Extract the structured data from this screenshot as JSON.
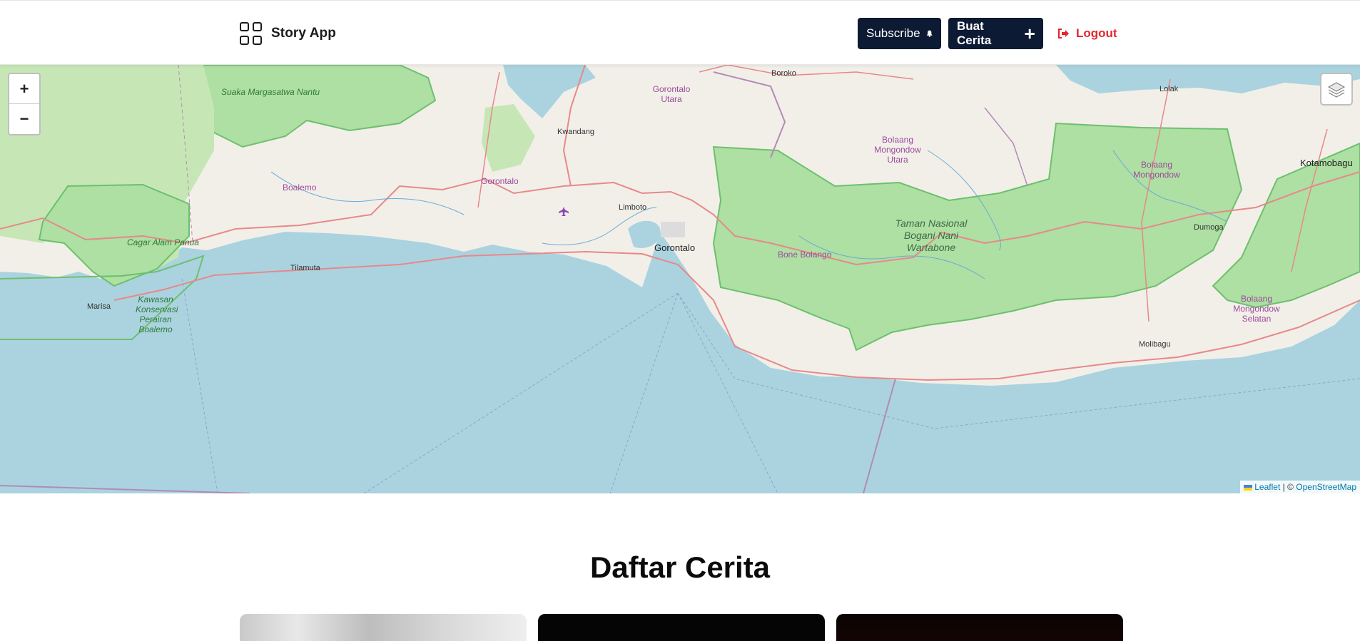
{
  "header": {
    "brand_icon": "grid-icon",
    "brand_title": "Story App",
    "subscribe_label": "Subscribe",
    "subscribe_icon": "bell-icon",
    "create_label": "Buat Cerita",
    "create_icon": "plus-icon",
    "logout_label": "Logout",
    "logout_icon": "logout-icon",
    "colors": {
      "primary": "#0c1a33",
      "danger": "#e3262e"
    }
  },
  "map": {
    "zoom_in": "+",
    "zoom_out": "−",
    "layers_icon": "layers-icon",
    "attribution": {
      "leaflet": "Leaflet",
      "separator": "|",
      "copyright": "©",
      "osm": "OpenStreetMap"
    },
    "labels": {
      "suaka": "Suaka Margasatwa Nantu",
      "boalemo": "Boalemo",
      "cagar": "Cagar Alam Panua",
      "tilamuta": "Tilamuta",
      "marisa": "Marisa",
      "kawasan": "Kawasan Konservasi Perairan Boalemo",
      "gorontalo_utara": "Gorontalo Utara",
      "kwandang": "Kwandang",
      "gorontalo_region": "Gorontalo",
      "limboto": "Limboto",
      "gorontalo_city": "Gorontalo",
      "boroko": "Boroko",
      "bolmong_utara": "Bolaang Mongondow Utara",
      "bone_bolango": "Bone Bolango",
      "taman": "Taman Nasional Bogani Nani Wartabone",
      "lolak": "Lolak",
      "bolmong": "Bolaang Mongondow",
      "kotamobagu": "Kotamobagu",
      "dumoga": "Dumoga",
      "bolmong_selatan": "Bolaang Mongondow Selatan",
      "molibagu": "Molibagu",
      "airport_icon": "airport-icon"
    }
  },
  "section": {
    "title": "Daftar Cerita"
  }
}
